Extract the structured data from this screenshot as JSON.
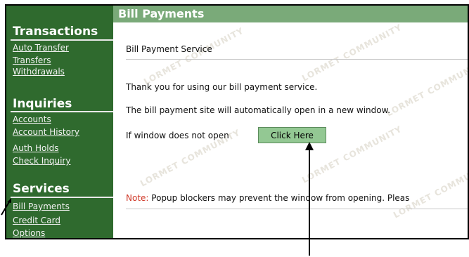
{
  "sidebar": {
    "sections": [
      {
        "title": "Transactions",
        "items": [
          "Auto Transfer",
          "Transfers",
          "Withdrawals"
        ]
      },
      {
        "title": "Inquiries",
        "items": [
          "Accounts",
          "Account History",
          "Auth Holds",
          "Check Inquiry"
        ]
      },
      {
        "title": "Services",
        "items": [
          "Bill Payments",
          "Credit Card",
          "Options"
        ]
      }
    ]
  },
  "content": {
    "header": "Bill Payments",
    "subtitle": "Bill Payment Service",
    "thank_you": "Thank you for using our bill payment service.",
    "auto_open": "The bill payment site will automatically open in a new window.",
    "if_window": "If window does not open",
    "button_label": "Click Here",
    "note_label": "Note:",
    "note_text": " Popup blockers may prevent the window from opening. Pleas",
    "watermark": "LORMET COMMUNITY"
  },
  "colors": {
    "sidebar_bg": "#2f6a2e",
    "header_bg": "#7aaa79",
    "button_bg": "#93c893",
    "note_red": "#d03a2a"
  }
}
